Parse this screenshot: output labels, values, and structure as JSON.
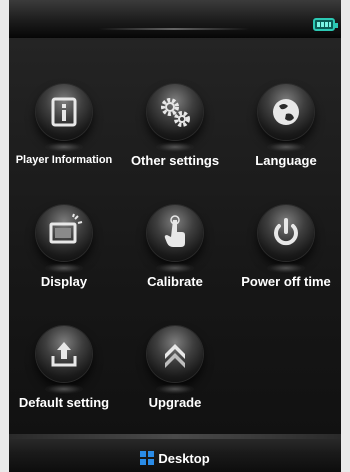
{
  "statusbar": {
    "battery_icon": "battery-full-icon",
    "accent_color": "#2cc9b4"
  },
  "menu": {
    "items": [
      {
        "label": "Player Information",
        "icon": "info-icon"
      },
      {
        "label": "Other settings",
        "icon": "gears-icon"
      },
      {
        "label": "Language",
        "icon": "language-icon"
      },
      {
        "label": "Display",
        "icon": "display-icon"
      },
      {
        "label": "Calibrate",
        "icon": "calibrate-touch-icon"
      },
      {
        "label": "Power off time",
        "icon": "power-icon"
      },
      {
        "label": "Default setting",
        "icon": "reset-upload-icon"
      },
      {
        "label": "Upgrade",
        "icon": "upgrade-chevrons-icon"
      }
    ]
  },
  "footer": {
    "label": "Desktop",
    "icon": "desktop-grid-icon",
    "icon_color": "#2a8be6"
  }
}
